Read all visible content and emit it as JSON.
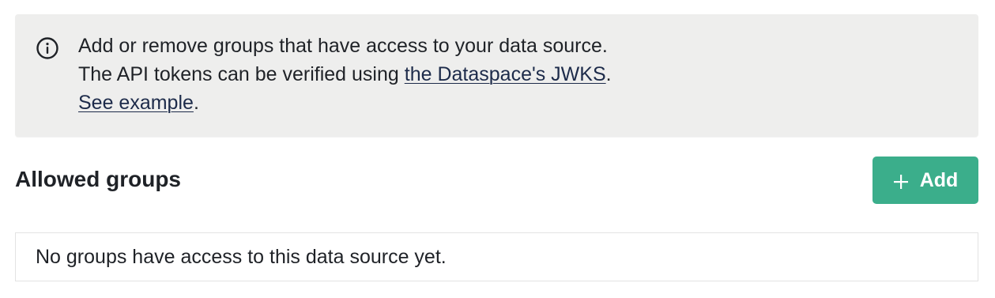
{
  "info": {
    "icon": "info-circle-icon",
    "line1": "Add or remove groups that have access to your data source.",
    "line2_prefix": "The API tokens can be verified using ",
    "line2_link": "the Dataspace's JWKS",
    "line2_suffix": ".",
    "line3_link": "See example",
    "line3_suffix": "."
  },
  "section": {
    "title": "Allowed groups",
    "add_button_label": "Add",
    "add_button_icon": "plus-icon",
    "add_button_color": "#3bae8b",
    "empty_message": "No groups have access to this data source yet."
  }
}
